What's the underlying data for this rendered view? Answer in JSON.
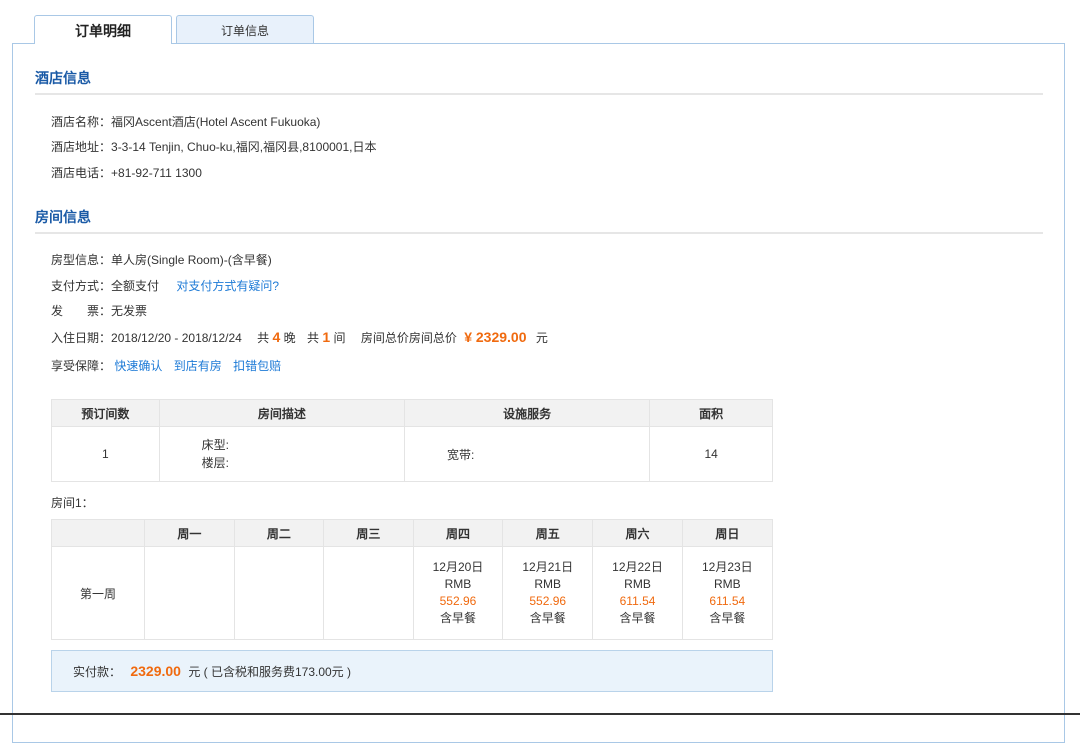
{
  "tabs": [
    {
      "label": "订单明细"
    },
    {
      "label": "订单信息"
    }
  ],
  "hotel_section": {
    "title": "酒店信息",
    "name_label": "酒店名称：",
    "name_value": "福冈Ascent酒店(Hotel Ascent Fukuoka)",
    "address_label": "酒店地址：",
    "address_value": "3-3-14 Tenjin, Chuo-ku,福冈,福冈县,8100001,日本",
    "phone_label": "酒店电话：",
    "phone_value": "+81-92-711 1300"
  },
  "room_section": {
    "title": "房间信息",
    "type_label": "房型信息：",
    "type_value": "单人房(Single Room)-(含早餐)",
    "payment_label": "支付方式：",
    "payment_value": "全额支付",
    "payment_link": "对支付方式有疑问?",
    "invoice_label": "发　　票：",
    "invoice_value": "无发票",
    "checkin_label": "入住日期：",
    "checkin_value": "2018/12/20 - 2018/12/24",
    "nights_prefix": "共",
    "nights_count": "4",
    "nights_suffix": "晚",
    "rooms_prefix": "共",
    "rooms_count": "1",
    "rooms_suffix": "间",
    "total_label": "房间总价房间总价",
    "total_value": "¥ 2329.00",
    "total_unit": "元",
    "guarantee_label": "享受保障：",
    "guarantees": [
      "快速确认",
      "到店有房",
      "扣错包赔"
    ]
  },
  "room_table": {
    "headers": [
      "预订间数",
      "房间描述",
      "设施服务",
      "面积"
    ],
    "count": "1",
    "bed_label": "床型:",
    "floor_label": "楼层:",
    "broadband_label": "宽带:",
    "area": "14"
  },
  "room1_label": "房间1：",
  "week_table": {
    "headers": [
      "",
      "周一",
      "周二",
      "周三",
      "周四",
      "周五",
      "周六",
      "周日"
    ],
    "row_label": "第一周",
    "days": [
      {
        "date": "12月20日",
        "currency": "RMB",
        "price": "552.96",
        "meal": "含早餐"
      },
      {
        "date": "12月21日",
        "currency": "RMB",
        "price": "552.96",
        "meal": "含早餐"
      },
      {
        "date": "12月22日",
        "currency": "RMB",
        "price": "611.54",
        "meal": "含早餐"
      },
      {
        "date": "12月23日",
        "currency": "RMB",
        "price": "611.54",
        "meal": "含早餐"
      }
    ]
  },
  "payment_summary": {
    "label": "实付款：",
    "amount": "2329.00",
    "note": "元 ( 已含税和服务费173.00元 )"
  },
  "colors": {
    "accent_blue": "#1a5aa6",
    "link_blue": "#1d7ad6",
    "price_orange": "#f06a0f"
  }
}
